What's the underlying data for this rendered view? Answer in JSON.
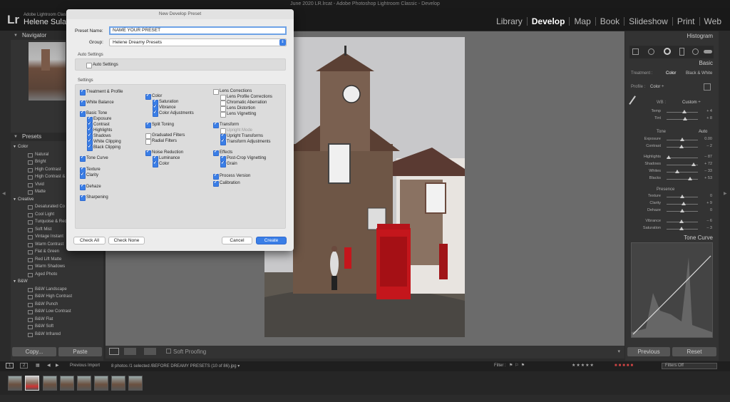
{
  "window_title": "June 2020 LR.lrcat - Adobe Photoshop Lightroom Classic - Develop",
  "app": {
    "logo": "Lr",
    "catalog": "Adobe Lightroom Classic",
    "user": "Helene Sula"
  },
  "modules": [
    "Library",
    "Develop",
    "Map",
    "Book",
    "Slideshow",
    "Print",
    "Web"
  ],
  "active_module": "Develop",
  "left": {
    "navigator": "Navigator",
    "presets": "Presets",
    "copy": "Copy...",
    "paste": "Paste"
  },
  "preset_groups": [
    {
      "name": "Color",
      "items": [
        "Natural",
        "Bright",
        "High Contrast",
        "High Contrast & Det",
        "Vivid",
        "Matte"
      ]
    },
    {
      "name": "Creative",
      "items": [
        "Desaturated Co",
        "Cool Light",
        "Turquoise & Red",
        "Soft Mist",
        "Vintage Instant",
        "Warm Contrast",
        "Flat & Green",
        "Red Lift Matte",
        "Warm Shadows",
        "Aged Photo"
      ]
    },
    {
      "name": "B&W",
      "items": [
        "B&W Landscape",
        "B&W High Contrast",
        "B&W Punch",
        "B&W Low Contrast",
        "B&W Flat",
        "B&W Soft",
        "B&W Infrared"
      ]
    }
  ],
  "dialog": {
    "title": "New Develop Preset",
    "preset_name_label": "Preset Name:",
    "preset_name_value": "NAME YOUR PRESET",
    "group_label": "Group:",
    "group_value": "Helene Dreamy Presets",
    "auto_settings_header": "Auto Settings",
    "auto_settings_check": "Auto Settings",
    "settings_header": "Settings",
    "col1": [
      "Treatment & Profile",
      "White Balance",
      "Basic Tone",
      "Exposure",
      "Contrast",
      "Highlights",
      "Shadows",
      "White Clipping",
      "Black Clipping",
      "Tone Curve",
      "Texture",
      "Clarity",
      "Dehaze",
      "Sharpening"
    ],
    "col2": [
      "Color",
      "Saturation",
      "Vibrance",
      "Color Adjustments",
      "Split Toning",
      "Graduated Filters",
      "Radial Filters",
      "Noise Reduction",
      "Luminance",
      "Color"
    ],
    "col3": [
      "Lens Corrections",
      "Lens Profile Corrections",
      "Chromatic Aberration",
      "Lens Distortion",
      "Lens Vignetting",
      "Transform",
      "Upright Mode",
      "Upright Transforms",
      "Transform Adjustments",
      "Effects",
      "Post-Crop Vignetting",
      "Grain",
      "Process Version",
      "Calibration"
    ],
    "check_all": "Check All",
    "check_none": "Check None",
    "cancel": "Cancel",
    "create": "Create"
  },
  "right": {
    "histogram": "Histogram",
    "basic": "Basic",
    "treatment": "Treatment :",
    "treat_color": "Color",
    "treat_bw": "Black & White",
    "profile": "Profile :",
    "profile_value": "Color ÷",
    "wb": "WB :",
    "wb_value": "Custom ÷",
    "tone": "Tone",
    "auto": "Auto",
    "presence": "Presence",
    "sliders": [
      {
        "label": "Temp",
        "value": "+ 4",
        "pos": 0.56
      },
      {
        "label": "Tint",
        "value": "+ 8",
        "pos": 0.6
      },
      {
        "label": "Exposure",
        "value": "0.00",
        "pos": 0.5
      },
      {
        "label": "Contrast",
        "value": "– 2",
        "pos": 0.48
      },
      {
        "label": "Highlights",
        "value": "– 87",
        "pos": 0.07
      },
      {
        "label": "Shadows",
        "value": "+ 72",
        "pos": 0.86
      },
      {
        "label": "Whites",
        "value": "– 33",
        "pos": 0.33
      },
      {
        "label": "Blacks",
        "value": "+ 53",
        "pos": 0.76
      },
      {
        "label": "Texture",
        "value": "0",
        "pos": 0.5
      },
      {
        "label": "Clarity",
        "value": "+ 9",
        "pos": 0.55
      },
      {
        "label": "Dehaze",
        "value": "0",
        "pos": 0.5
      },
      {
        "label": "Vibrance",
        "value": "– 6",
        "pos": 0.47
      },
      {
        "label": "Saturation",
        "value": "– 3",
        "pos": 0.48
      }
    ],
    "tone_curve": "Tone Curve",
    "previous": "Previous",
    "reset": "Reset"
  },
  "toolbar": {
    "soft_proofing": "Soft Proofing"
  },
  "filmstrip": {
    "pages": [
      "1",
      "2"
    ],
    "source": "Previous Import",
    "info": "8 photos /1 selected /BEFORE DREAMY PRESETS (10 of 86).jpg ▾",
    "filter": "Filter :",
    "filters_off": "Filters Off"
  },
  "colors": {
    "accent": "#3a7ee6",
    "panel": "#333333",
    "canvas": "#6b6b6b"
  }
}
